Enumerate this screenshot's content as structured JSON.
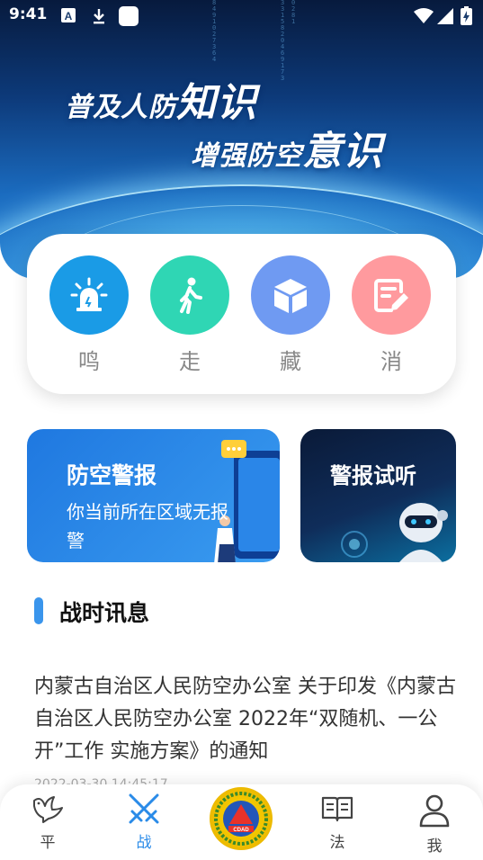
{
  "status_bar": {
    "time": "9:41"
  },
  "hero": {
    "line1_a": "普及人防",
    "line1_b": "知识",
    "line2_a": "增强防空",
    "line2_b": "意识"
  },
  "actions": [
    {
      "label": "鸣",
      "color": "#1a9be6",
      "icon": "siren-icon"
    },
    {
      "label": "走",
      "color": "#2fd6b4",
      "icon": "walking-person-icon"
    },
    {
      "label": "藏",
      "color": "#6f9af2",
      "icon": "cube-icon"
    },
    {
      "label": "消",
      "color": "#ff9a9e",
      "icon": "edit-note-icon"
    }
  ],
  "alarm_card": {
    "title": "防空警报",
    "desc": "你当前所在区域无报警"
  },
  "listen_card": {
    "title": "警报试听"
  },
  "section": {
    "title": "战时讯息"
  },
  "news": {
    "title": "内蒙古自治区人民防空办公室  关于印发《内蒙古自治区人民防空办公室  2022年“双随机、一公开”工作  实施方案》的通知",
    "date": "2022-03-30 14:45:17"
  },
  "tabs": [
    {
      "label": "平",
      "icon": "dove-icon"
    },
    {
      "label": "战",
      "icon": "crossed-swords-icon",
      "active": true
    },
    {
      "label": "法",
      "icon": "book-icon"
    },
    {
      "label": "我",
      "icon": "person-icon"
    }
  ],
  "colors": {
    "accent": "#2a8be8",
    "alarm_blue": "#1f78e0"
  }
}
